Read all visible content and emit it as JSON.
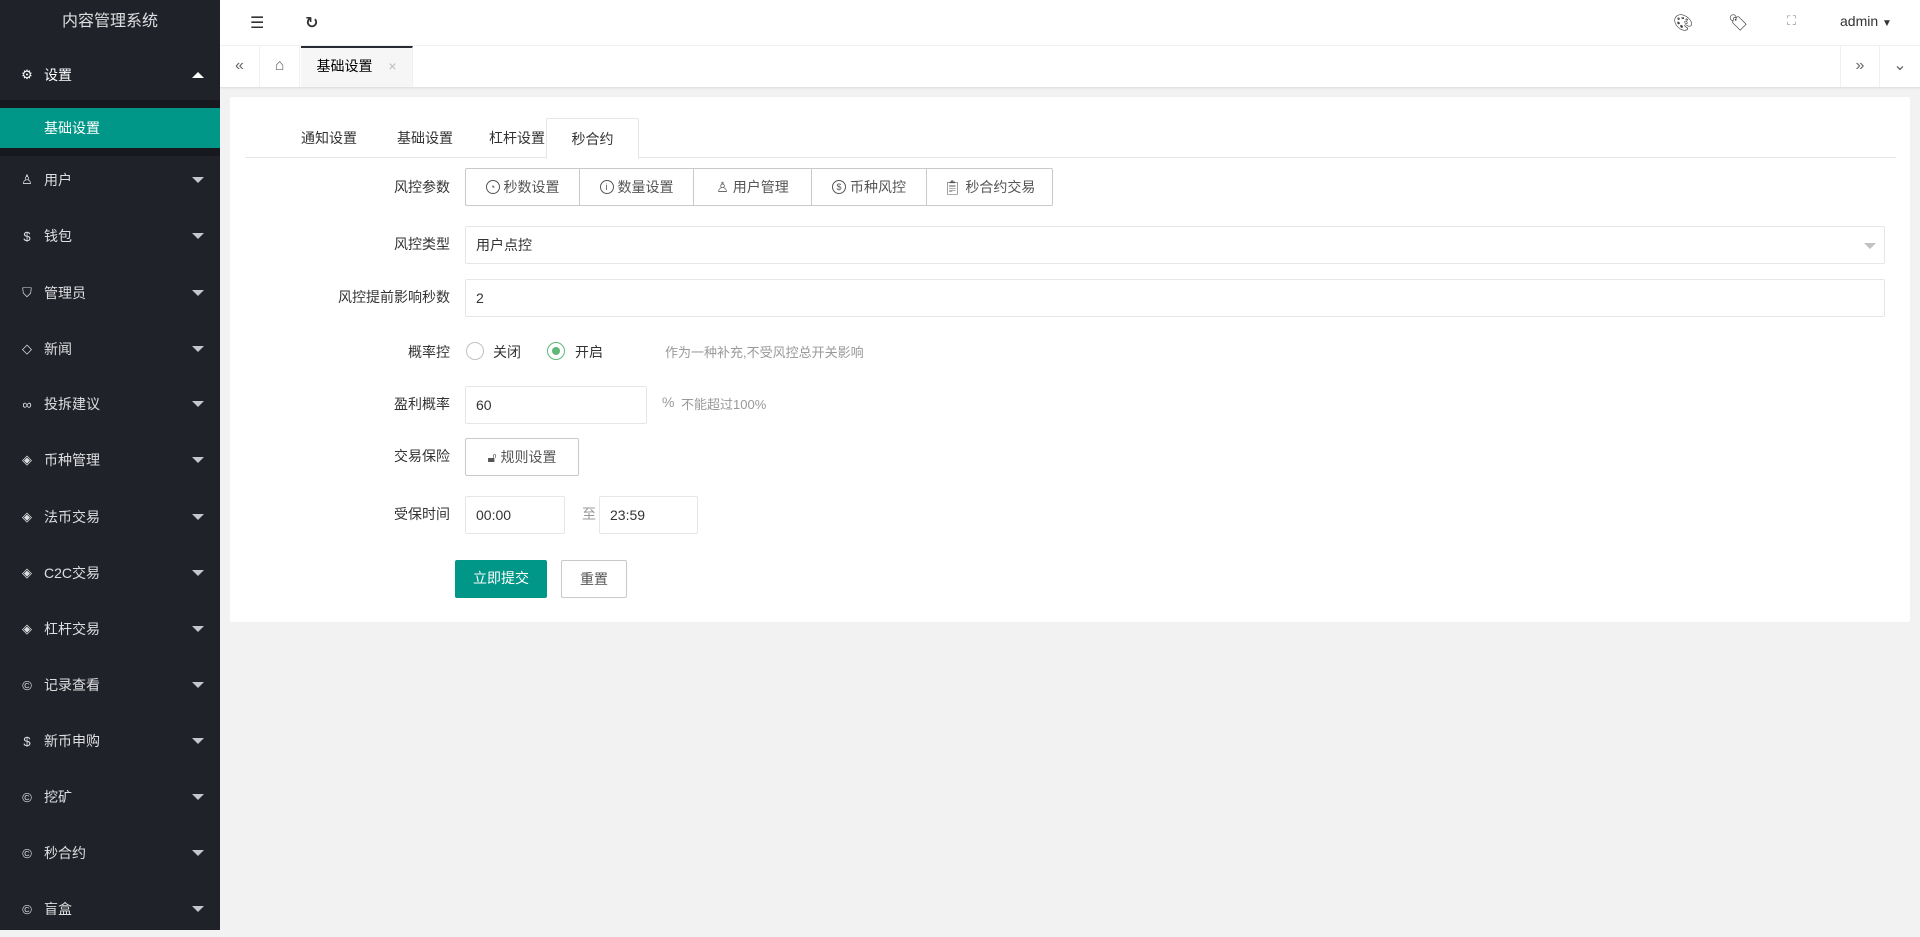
{
  "app": {
    "title": "内容管理系统"
  },
  "sidebar": {
    "items": [
      {
        "label": "设置",
        "icon": "gear-icon",
        "expanded": true,
        "children": [
          {
            "label": "基础设置",
            "active": true
          }
        ]
      },
      {
        "label": "用户",
        "icon": "user-icon"
      },
      {
        "label": "钱包",
        "icon": "dollar-icon"
      },
      {
        "label": "管理员",
        "icon": "shield-icon"
      },
      {
        "label": "新闻",
        "icon": "tag-icon"
      },
      {
        "label": "投拆建议",
        "icon": "link-icon"
      },
      {
        "label": "币种管理",
        "icon": "diamond-icon"
      },
      {
        "label": "法币交易",
        "icon": "diamond-icon"
      },
      {
        "label": "C2C交易",
        "icon": "diamond-icon"
      },
      {
        "label": "杠杆交易",
        "icon": "diamond-icon"
      },
      {
        "label": "记录查看",
        "icon": "coin-icon"
      },
      {
        "label": "新币申购",
        "icon": "dollar-icon"
      },
      {
        "label": "挖矿",
        "icon": "coin-icon"
      },
      {
        "label": "秒合约",
        "icon": "coin-icon"
      },
      {
        "label": "盲盒",
        "icon": "coin-icon"
      }
    ]
  },
  "header": {
    "user": "admin"
  },
  "pagetabs": {
    "items": [
      {
        "label": "基础设置"
      }
    ]
  },
  "tabs": [
    {
      "label": "通知设置"
    },
    {
      "label": "基础设置"
    },
    {
      "label": "杠杆设置"
    },
    {
      "label": "秒合约",
      "active": true
    }
  ],
  "form": {
    "risk_params": {
      "label": "风控参数",
      "buttons": [
        {
          "label": "秒数设置",
          "icon": "clock-icon"
        },
        {
          "label": "数量设置",
          "icon": "info-icon"
        },
        {
          "label": "用户管理",
          "icon": "user-icon"
        },
        {
          "label": "币种风控",
          "icon": "dollar-icon"
        },
        {
          "label": "秒合约交易",
          "icon": "clipboard-icon"
        }
      ]
    },
    "risk_type": {
      "label": "风控类型",
      "value": "用户点控"
    },
    "advance_seconds": {
      "label": "风控提前影响秒数",
      "value": "2"
    },
    "prob_control": {
      "label": "概率控",
      "options": [
        "关闭",
        "开启"
      ],
      "selected": "开启",
      "hint": "作为一种补充,不受风控总开关影响"
    },
    "profit_rate": {
      "label": "盈利概率",
      "value": "60",
      "unit": "%",
      "hint": "不能超过100%"
    },
    "insurance": {
      "label": "交易保险",
      "button": "规则设置"
    },
    "protect_time": {
      "label": "受保时间",
      "from": "00:00",
      "sep": "至",
      "to": "23:59"
    },
    "submit": "立即提交",
    "reset": "重置"
  },
  "colors": {
    "accent": "#009688",
    "sidebar": "#20222a",
    "radio": "#5fb878"
  }
}
